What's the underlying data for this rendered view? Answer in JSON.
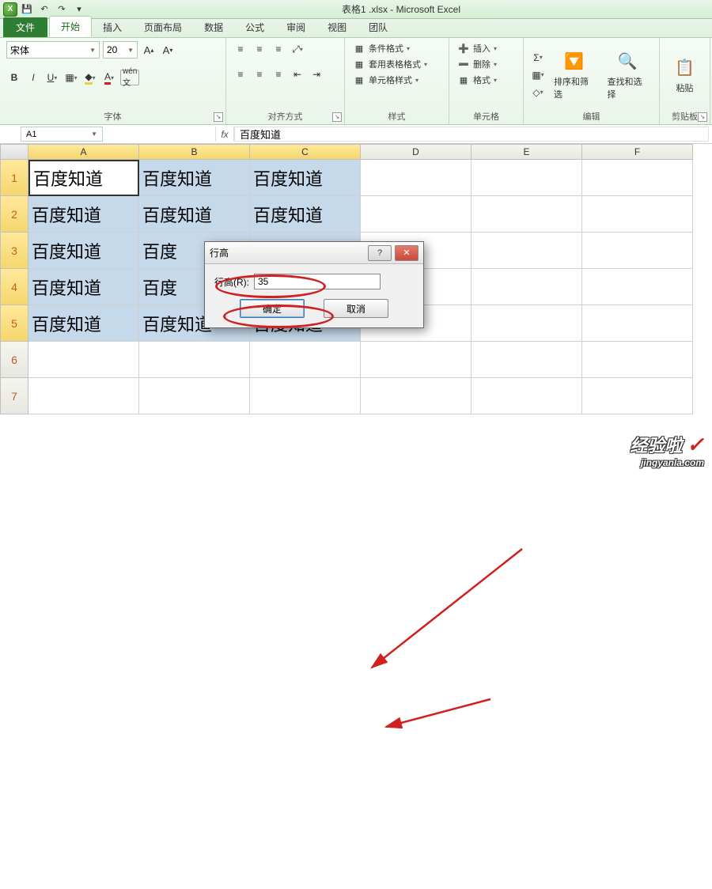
{
  "window": {
    "title": "表格1 .xlsx - Microsoft Excel"
  },
  "qat": {
    "save": "💾",
    "undo": "↶",
    "redo": "↷"
  },
  "tabs": {
    "file": "文件",
    "home": "开始",
    "insert": "插入",
    "layout": "页面布局",
    "data": "数据",
    "formula": "公式",
    "review": "审阅",
    "view": "视图",
    "team": "团队"
  },
  "ribbon": {
    "font_group": "字体",
    "font_name": "宋体",
    "font_size": "20",
    "align_group": "对齐方式",
    "styles_group": "样式",
    "cond_fmt": "条件格式",
    "table_fmt": "套用表格格式",
    "cell_style": "单元格样式",
    "cells_group": "单元格",
    "insert": "插入",
    "delete": "删除",
    "format": "格式",
    "edit_group": "编辑",
    "sort_filter": "排序和筛选",
    "find_select": "查找和选择",
    "clipboard_group": "剪贴板",
    "paste": "粘贴"
  },
  "formula_bar": {
    "name": "A1",
    "fx": "fx",
    "value": "百度知道"
  },
  "columns": [
    "A",
    "B",
    "C",
    "D",
    "E",
    "F"
  ],
  "rows": [
    "1",
    "2",
    "3",
    "4",
    "5",
    "6",
    "7"
  ],
  "cells": {
    "r1": [
      "百度知道",
      "百度知道",
      "百度知道",
      "",
      "",
      ""
    ],
    "r2": [
      "百度知道",
      "百度知道",
      "百度知道",
      "",
      "",
      ""
    ],
    "r3": [
      "百度知道",
      "百度",
      "",
      "",
      "",
      ""
    ],
    "r4": [
      "百度知道",
      "百度",
      "",
      "",
      "",
      ""
    ],
    "r5": [
      "百度知道",
      "百度知道",
      "百度知道",
      "",
      "",
      ""
    ]
  },
  "dialog": {
    "title": "行高",
    "label": "行高(R):",
    "value": "35",
    "ok": "确定",
    "cancel": "取消"
  },
  "watermark": {
    "line1": "经验啦",
    "check": "✓",
    "line2": "jingyanla.com"
  }
}
